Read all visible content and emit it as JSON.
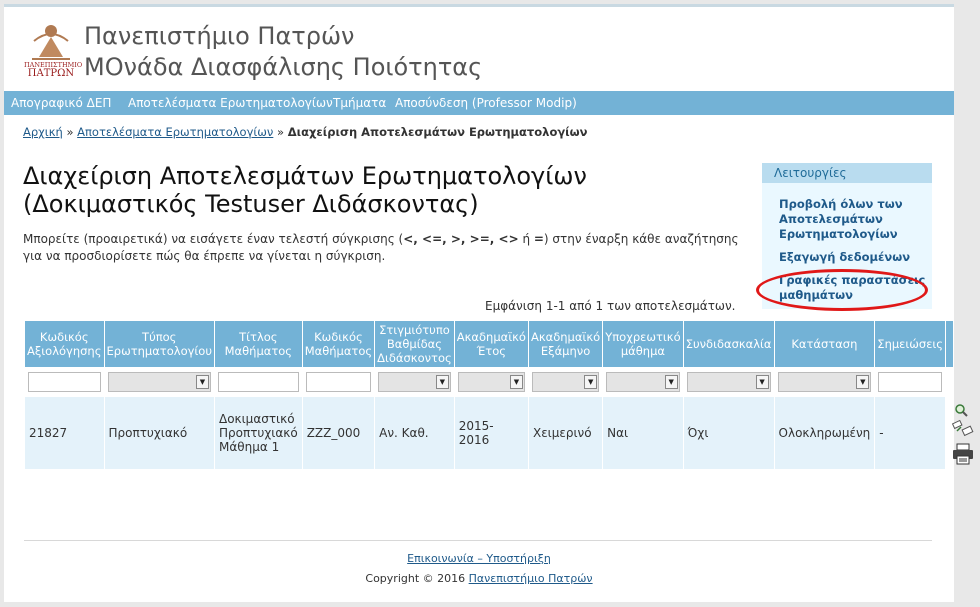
{
  "header": {
    "title_line1": "Πανεπιστήμιο Πατρών",
    "title_line2": "ΜΟνάδα Διασφάλισης Ποιότητας",
    "logo_text_small": "ΠΑΝΕΠΙΣΤΗΜΙΟ",
    "logo_text_big": "ΠΑΤΡΩΝ"
  },
  "nav": {
    "items": [
      {
        "label": "Απογραφικό ΔΕΠ"
      },
      {
        "label": "Αποτελέσματα Ερωτηματολογίων"
      },
      {
        "label": "Τμήματα"
      },
      {
        "label": "Αποσύνδεση (Professor Modip)"
      }
    ]
  },
  "breadcrumb": {
    "home": "Αρχική",
    "sep": "»",
    "results": "Αποτελέσματα Ερωτηματολογίων",
    "current": "Διαχείριση Αποτελεσμάτων Ερωτηματολογίων"
  },
  "page": {
    "title_line1": "Διαχείριση Αποτελεσμάτων Ερωτηματολογίων",
    "title_line2": "(Δοκιμαστικός Testuser Διδάσκοντας)",
    "intro_pre": "Μπορείτε (προαιρετικά) να εισάγετε έναν τελεστή σύγκρισης (",
    "intro_ops": "<, <=, >, >=, <>",
    "intro_mid": " ή ",
    "intro_eq": "=",
    "intro_post": ") στην έναρξη κάθε αναζήτησης για να προσδιορίσετε πώς θα έπρεπε να γίνεται η σύγκριση.",
    "summary": "Εμφάνιση 1-1 από 1 των αποτελεσμάτων."
  },
  "sidebar": {
    "heading": "Λειτουργίες",
    "links": [
      {
        "label": "Προβολή όλων των Αποτελεσμάτων Ερωτηματολογίων"
      },
      {
        "label": "Εξαγωγή δεδομένων"
      },
      {
        "label": "Γραφικές παραστάσεις μαθημάτων"
      }
    ],
    "highlight_color": "#e01818"
  },
  "table": {
    "headers": [
      "Κωδικός Αξιολόγησης",
      "Τύπος Ερωτηματολογίου",
      "Τίτλος Μαθήματος",
      "Κωδικός Μαθήματος",
      "Στιγμιότυπο Βαθμίδας Διδάσκοντος",
      "Ακαδημαϊκό Έτος",
      "Ακαδημαϊκό Εξάμηνο",
      "Υποχρεωτικό μάθημα",
      "Συνδιδασκαλία",
      "Κατάσταση",
      "Σημειώσεις"
    ],
    "row": {
      "code": "21827",
      "type": "Προπτυχιακό",
      "course_title": "Δοκιμαστικό Προπτυχιακό Μάθημα 1",
      "course_code": "ZZZ_000",
      "rank": "Αν. Καθ.",
      "year": "2015-2016",
      "semester": "Χειμερινό",
      "mandatory": "Ναι",
      "coteaching": "Όχι",
      "status": "Ολοκληρωμένη",
      "notes": "-"
    },
    "action_icons": [
      "view-icon",
      "chart-icon",
      "print-icon"
    ]
  },
  "footer": {
    "contact": "Επικοινωνία – Υποστήριξη",
    "copyright": "Copyright © 2016 ",
    "university": "Πανεπιστήμιο Πατρών"
  },
  "colors": {
    "nav_bg": "#73b2d6",
    "row_bg": "#e4f2fa",
    "sidebar_bg": "#eaf8ff",
    "link": "#1f5a8a"
  }
}
